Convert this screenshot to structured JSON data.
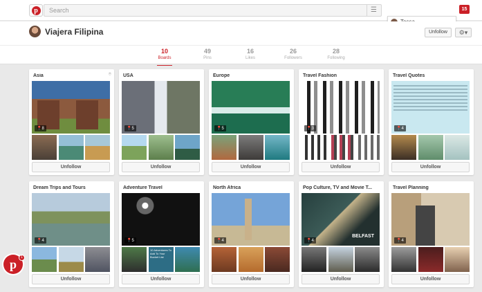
{
  "header": {
    "search_placeholder": "Search",
    "notifications": "15",
    "user_menu_name": "Tessa"
  },
  "profile": {
    "name": "Viajera Filipina",
    "follow_button": "Unfollow"
  },
  "stats": [
    {
      "count": "10",
      "label": "Boards",
      "active": true
    },
    {
      "count": "49",
      "label": "Pins"
    },
    {
      "count": "16",
      "label": "Likes"
    },
    {
      "count": "26",
      "label": "Followers"
    },
    {
      "count": "28",
      "label": "Following"
    }
  ],
  "boards": [
    {
      "title": "Asia",
      "pins": "8",
      "button": "Unfollow",
      "cover_text": ""
    },
    {
      "title": "USA",
      "pins": "5",
      "button": "Unfollow",
      "cover_text": ""
    },
    {
      "title": "Europe",
      "pins": "5",
      "button": "Unfollow",
      "cover_text": ""
    },
    {
      "title": "Travel Fashion",
      "pins": "3",
      "button": "Unfollow",
      "cover_text": ""
    },
    {
      "title": "Travel Quotes",
      "pins": "4",
      "button": "Unfollow",
      "cover_text": ""
    },
    {
      "title": "Dream Trips and Tours",
      "pins": "4",
      "button": "Unfollow",
      "cover_text": ""
    },
    {
      "title": "Adventure Travel",
      "pins": "5",
      "button": "Unfollow",
      "cover_text": "10 Adventures To Add To Your Bucket List"
    },
    {
      "title": "North Africa",
      "pins": "4",
      "button": "Unfollow",
      "cover_text": ""
    },
    {
      "title": "Pop Culture, TV and Movie T...",
      "pins": "4",
      "button": "Unfollow",
      "cover_text": "BELFAST"
    },
    {
      "title": "Travel Planning",
      "pins": "4",
      "button": "Unfollow",
      "cover_text": ""
    }
  ],
  "floating_badge": "1",
  "colors": {
    "brand": "#cb2027"
  }
}
